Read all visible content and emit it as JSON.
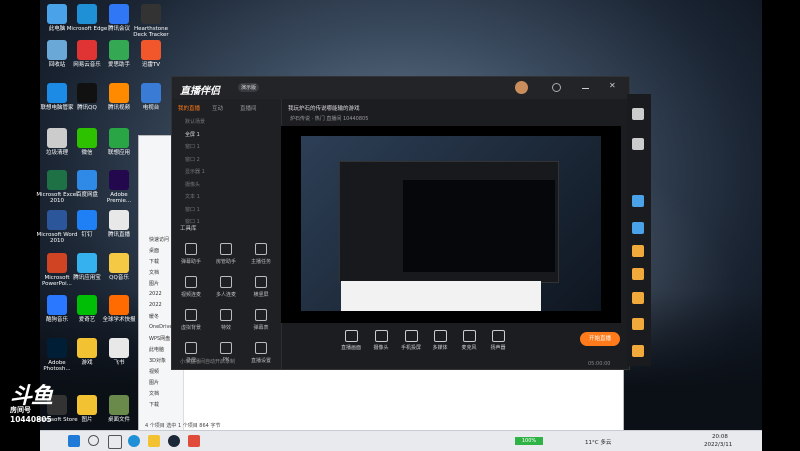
{
  "desktop_icons": [
    {
      "label": "此电脑",
      "color": "#4aa3e8"
    },
    {
      "label": "Microsoft Edge",
      "color": "#1f8fd6"
    },
    {
      "label": "腾讯会议",
      "color": "#2f77f4"
    },
    {
      "label": "Hearthstone Deck Tracker",
      "color": "#333333"
    },
    {
      "label": "回收站",
      "color": "#6aa8d8"
    },
    {
      "label": "网易云音乐",
      "color": "#e03434"
    },
    {
      "label": "爱思助手",
      "color": "#35a853"
    },
    {
      "label": "迅雷TV",
      "color": "#f2562b"
    },
    {
      "label": "联想电脑管家",
      "color": "#1c8be6"
    },
    {
      "label": "腾讯QQ",
      "color": "#111111"
    },
    {
      "label": "腾讯视频",
      "color": "#ff8a00"
    },
    {
      "label": "电视台",
      "color": "#3a7bd5"
    },
    {
      "label": "垃圾清理",
      "color": "#cccccc"
    },
    {
      "label": "微信",
      "color": "#2dc100"
    },
    {
      "label": "联想应用",
      "color": "#2aa546"
    },
    {
      "label": "Microsoft Excel 2010",
      "color": "#1e7145"
    },
    {
      "label": "百度网盘",
      "color": "#2e8ae6"
    },
    {
      "label": "Adobe Premie...",
      "color": "#23084d"
    },
    {
      "label": "Microsoft Word 2010",
      "color": "#2b579a"
    },
    {
      "label": "钉钉",
      "color": "#1f7ff5"
    },
    {
      "label": "腾讯直播",
      "color": "#e8e8e8"
    },
    {
      "label": "Microsoft PowerPoi...",
      "color": "#d04423"
    },
    {
      "label": "腾讯应用宝",
      "color": "#35b1f0"
    },
    {
      "label": "QQ音乐",
      "color": "#f6c945"
    },
    {
      "label": "酷狗音乐",
      "color": "#2a78ff"
    },
    {
      "label": "爱奇艺",
      "color": "#00be06"
    },
    {
      "label": "全球学术快报",
      "color": "#ff6b00"
    },
    {
      "label": "Adobe Photosh...",
      "color": "#001e36"
    },
    {
      "label": "游戏",
      "color": "#f3c233"
    },
    {
      "label": "飞书",
      "color": "#e8e8e8"
    },
    {
      "label": "Microsoft Store",
      "color": "#333333"
    },
    {
      "label": "图片",
      "color": "#f3c233"
    },
    {
      "label": "桌面文件",
      "color": "#6a8a4b"
    }
  ],
  "explorer": {
    "left_items": [
      "快速访问",
      "桌面",
      "下载",
      "文档",
      "图片",
      "2022",
      "2022",
      "暖冬",
      "OneDrive",
      "WPS网盘",
      "此电脑",
      "3D对象",
      "视频",
      "图片",
      "文档",
      "下载"
    ],
    "status": "4 个项目  选中 1 个项目  864 字节"
  },
  "app": {
    "logo": "直播伴侣",
    "badge": "演示版",
    "tabs": [
      "我的直播",
      "互动",
      "直播间"
    ],
    "scenes": [
      "默认场景",
      "全屏 1",
      "窗口 1",
      "窗口 2",
      "显示器 1",
      "摄像头",
      "文本 1",
      "窗口 1",
      "窗口 1"
    ],
    "tools_title": "工具库",
    "tools": [
      "弹幕助手",
      "房管助手",
      "主播任务",
      "视频连麦",
      "多人连麦",
      "横竖屏",
      "虚拟背景",
      "特效",
      "弹幕表",
      "录屏",
      "PK",
      "直播设置"
    ],
    "bottom_notice": "小米直播间自动开启录制",
    "title_line": "我玩炉石的传说哪能输的游戏",
    "room_info": "炉石传说 · 热门  直播间 10440805",
    "controls": [
      "直播画面",
      "摄像头",
      "手机投屏",
      "多媒体",
      "麦克风",
      "扬声器"
    ],
    "start_label": "开始直播",
    "clock": "05:00:00"
  },
  "taskbar": {
    "battery": "100%",
    "weather": "11°C 多云",
    "time": "20:08",
    "date": "2022/3/11"
  },
  "watermark": {
    "brand": "斗鱼",
    "sub": "房间号",
    "room": "10440805"
  },
  "colors": {
    "accent": "#ff7a1a",
    "app_bg": "#1c1d21"
  }
}
